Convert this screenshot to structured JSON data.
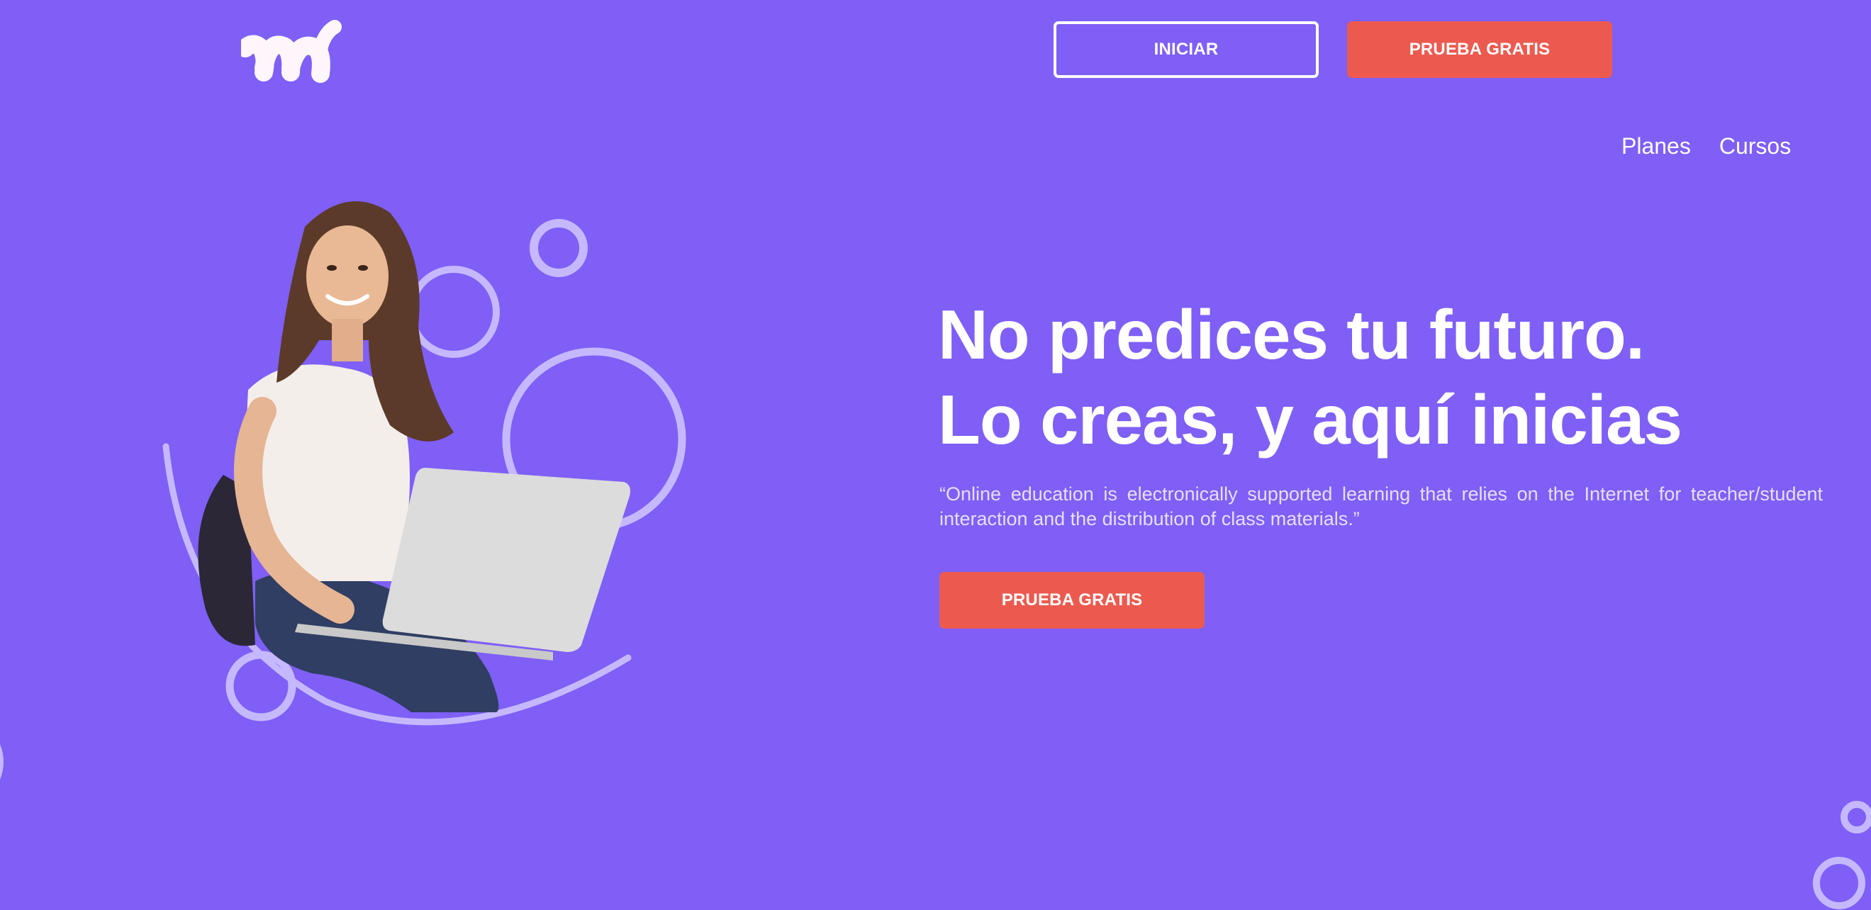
{
  "colors": {
    "background": "#7f5ff6",
    "accent_red": "#ec5a4f",
    "white": "#ffffff",
    "ring": "#c6b8ff"
  },
  "header": {
    "logo_icon": "brand-logo",
    "login_label": "INICIAR",
    "trial_label": "PRUEBA GRATIS"
  },
  "nav": {
    "items": [
      {
        "label": "Planes"
      },
      {
        "label": "Cursos"
      }
    ]
  },
  "hero": {
    "headline_line1": "No predices tu futuro.",
    "headline_line2": "Lo creas, y aquí inicias",
    "quote": "“Online education is electronically supported learning that relies on the Internet for teacher/student interaction and the distribution of class materials.”",
    "cta_label": "PRUEBA GRATIS",
    "image_icon": "student-laptop-illustration"
  }
}
